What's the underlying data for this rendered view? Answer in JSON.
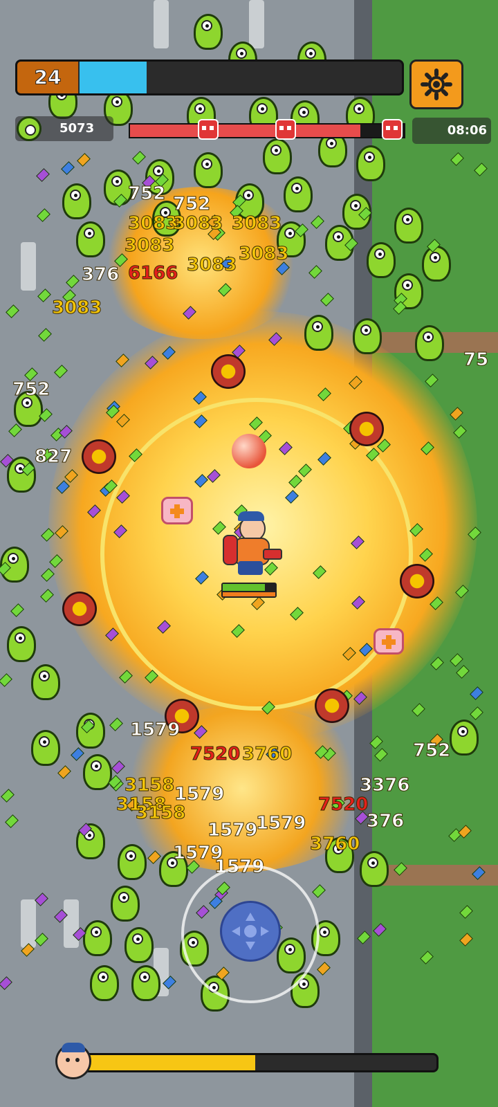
{
  "hud": {
    "level": "24",
    "xp_fill_fraction": 0.21,
    "coins": "5073",
    "timer": "08:06",
    "boss_progress_fraction": 0.84,
    "player_hp_fraction": 0.8,
    "wave_progress_fraction": 0.5
  },
  "damage_numbers": [
    {
      "text": "752",
      "color": "#ffffff"
    },
    {
      "text": "3083",
      "color": "#f2c40a"
    },
    {
      "text": "3083",
      "color": "#f2c40a"
    },
    {
      "text": "3083",
      "color": "#f2c40a"
    },
    {
      "text": "752",
      "color": "#ffffff"
    },
    {
      "text": "3083",
      "color": "#f2c40a"
    },
    {
      "text": "3083",
      "color": "#f2c40a"
    },
    {
      "text": "376",
      "color": "#ffffff"
    },
    {
      "text": "6166",
      "color": "#e3201b"
    },
    {
      "text": "3083",
      "color": "#f2c40a"
    },
    {
      "text": "3083",
      "color": "#f2c40a"
    },
    {
      "text": "752",
      "color": "#ffffff"
    },
    {
      "text": "827",
      "color": "#ffffff"
    },
    {
      "text": "75",
      "color": "#ffffff"
    },
    {
      "text": "1579",
      "color": "#ffffff"
    },
    {
      "text": "7520",
      "color": "#e3201b"
    },
    {
      "text": "3158",
      "color": "#f2c40a"
    },
    {
      "text": "1579",
      "color": "#ffffff"
    },
    {
      "text": "3158",
      "color": "#f2c40a"
    },
    {
      "text": "3158",
      "color": "#f2c40a"
    },
    {
      "text": "3760",
      "color": "#f2c40a"
    },
    {
      "text": "7520",
      "color": "#e3201b"
    },
    {
      "text": "376",
      "color": "#ffffff"
    },
    {
      "text": "1579",
      "color": "#ffffff"
    },
    {
      "text": "1579",
      "color": "#ffffff"
    },
    {
      "text": "3760",
      "color": "#f2c40a"
    },
    {
      "text": "1579",
      "color": "#ffffff"
    },
    {
      "text": "1579",
      "color": "#ffffff"
    },
    {
      "text": "752",
      "color": "#ffffff"
    },
    {
      "text": "3376",
      "color": "#ffffff"
    }
  ],
  "colors": {
    "level_badge": "#c4660e",
    "xp_bar": "#38c0ee",
    "settings_button": "#f39a1c",
    "boss_bar": "#e74c4c",
    "progress_bar": "#f7c614",
    "hp_bar": "#63c22d"
  },
  "icons": {
    "settings": "gear-icon",
    "coins": "coin-icon",
    "boss": "boss-skull-icon",
    "player": "player-avatar-icon",
    "joystick": "joystick-icon"
  }
}
